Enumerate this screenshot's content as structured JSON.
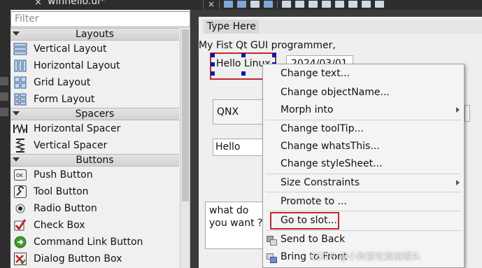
{
  "window": {
    "tab_title": "winhello.ui*",
    "tab_close": "×"
  },
  "widgetbox": {
    "filter_placeholder": "Filter",
    "categories": {
      "layouts": "Layouts",
      "spacers": "Spacers",
      "buttons": "Buttons"
    },
    "layouts": [
      {
        "label": "Vertical Layout",
        "icon": "vertical-layout-icon"
      },
      {
        "label": "Horizontal Layout",
        "icon": "horizontal-layout-icon"
      },
      {
        "label": "Grid Layout",
        "icon": "grid-layout-icon"
      },
      {
        "label": "Form Layout",
        "icon": "form-layout-icon"
      }
    ],
    "spacers": [
      {
        "label": "Horizontal Spacer",
        "icon": "horizontal-spacer-icon"
      },
      {
        "label": "Vertical Spacer",
        "icon": "vertical-spacer-icon"
      }
    ],
    "buttons": [
      {
        "label": "Push Button",
        "icon": "push-button-icon"
      },
      {
        "label": "Tool Button",
        "icon": "tool-button-icon"
      },
      {
        "label": "Radio Button",
        "icon": "radio-button-icon"
      },
      {
        "label": "Check Box",
        "icon": "check-box-icon"
      },
      {
        "label": "Command Link Button",
        "icon": "command-link-icon"
      },
      {
        "label": "Dialog Button Box",
        "icon": "dialog-button-box-icon"
      }
    ]
  },
  "form": {
    "menu_placeholder": "Type Here",
    "label_text": "My Fist Qt GUI programmer,",
    "hello_linux": "Hello Linux",
    "date_value": "2024/03/01",
    "combo_value": "QNX",
    "line_edit_value": "Hello",
    "text_edit_value": "what do you want ?"
  },
  "context_menu": {
    "items": [
      "Change text...",
      "Change objectName...",
      "Morph into",
      "Change toolTip...",
      "Change whatsThis...",
      "Change styleSheet...",
      "Size Constraints",
      "Promote to ...",
      "Go to slot...",
      "Send to Back",
      "Bring to Front"
    ],
    "mnemonic_send": "B",
    "mnemonic_bring": "F"
  },
  "watermark": "CSDN @小狗爱吃黄桃罐头",
  "colors": {
    "highlight_border": "#c0282d",
    "selection_handle": "#001aa6",
    "panel_bg": "#f0f0f0"
  }
}
